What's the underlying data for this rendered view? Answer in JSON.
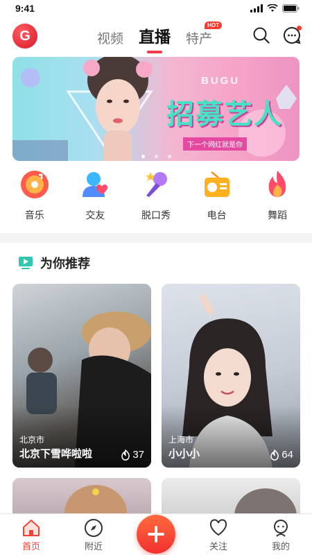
{
  "status_bar": {
    "time": "9:41"
  },
  "top_nav": {
    "logo_letter": "G",
    "tabs": [
      {
        "label": "视频",
        "active": false
      },
      {
        "label": "直播",
        "active": true
      },
      {
        "label": "特产",
        "active": false,
        "badge": "HOT"
      }
    ]
  },
  "banner": {
    "brand": "BUGU",
    "title": "招募艺人",
    "subtitle": "下一个网红就是你",
    "page_count": 3,
    "active_index": 0
  },
  "categories": [
    {
      "label": "音乐",
      "icon": "music-note-icon",
      "color": "#ff5a4a"
    },
    {
      "label": "交友",
      "icon": "friend-heart-icon",
      "color": "#3ab7ff"
    },
    {
      "label": "脱口秀",
      "icon": "microphone-star-icon",
      "color": "#9b5cf0"
    },
    {
      "label": "电台",
      "icon": "radio-icon",
      "color": "#ffb020"
    },
    {
      "label": "舞蹈",
      "icon": "flame-icon",
      "color": "#ff4a6a"
    }
  ],
  "recommend": {
    "title": "为你推荐",
    "cards": [
      {
        "city": "北京市",
        "name": "北京下雪哗啦啦",
        "heat": "37"
      },
      {
        "city": "上海市",
        "name": "小小小",
        "heat": "64"
      }
    ]
  },
  "bottom_nav": [
    {
      "label": "首页",
      "icon": "home-icon",
      "active": true
    },
    {
      "label": "附近",
      "icon": "compass-icon",
      "active": false
    },
    {
      "label": "关注",
      "icon": "heart-icon",
      "active": false
    },
    {
      "label": "我的",
      "icon": "profile-icon",
      "active": false
    }
  ],
  "colors": {
    "accent": "#f23a4a",
    "tab_active": "#f0433a"
  }
}
